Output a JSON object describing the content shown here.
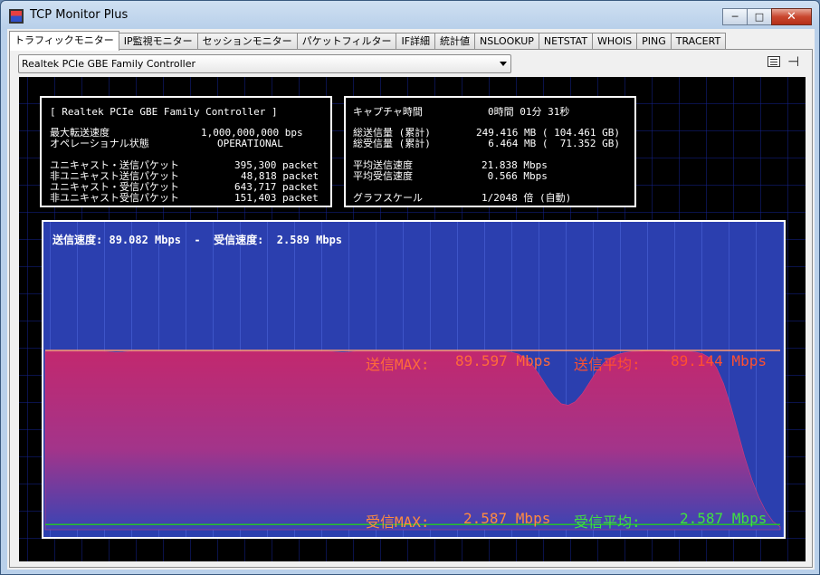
{
  "window": {
    "title": "TCP Monitor Plus",
    "minimize_glyph": "─",
    "maximize_glyph": "□",
    "close_glyph": "✕"
  },
  "tabs": [
    {
      "label": "トラフィックモニター",
      "active": true
    },
    {
      "label": "IP監視モニター"
    },
    {
      "label": "セッションモニター"
    },
    {
      "label": "パケットフィルター"
    },
    {
      "label": "IF詳細"
    },
    {
      "label": "統計値"
    },
    {
      "label": "NSLOOKUP"
    },
    {
      "label": "NETSTAT"
    },
    {
      "label": "WHOIS"
    },
    {
      "label": "PING"
    },
    {
      "label": "TRACERT"
    }
  ],
  "adapter_select": {
    "value": "Realtek PCIe GBE Family Controller"
  },
  "toolbar_icons": [
    "menu-icon",
    "pin-icon"
  ],
  "interface_info": {
    "header": "[ Realtek PCIe GBE Family Controller ]",
    "rows": [
      {
        "label": "最大転送速度",
        "value": "1,000,000,000 bps"
      },
      {
        "label": "オペレーショナル状態",
        "value": "OPERATIONAL"
      },
      {
        "label": "ユニキャスト・送信パケット",
        "value": "395,300 packet"
      },
      {
        "label": "非ユニキャスト送信パケット",
        "value": "48,818 packet"
      },
      {
        "label": "ユニキャスト・受信パケット",
        "value": "643,717 packet"
      },
      {
        "label": "非ユニキャスト受信パケット",
        "value": "151,403 packet"
      }
    ]
  },
  "capture_info": {
    "rows": [
      {
        "label": "キャプチャ時間",
        "value": "0時間 01分 31秒"
      },
      {
        "label": "総送信量 (累計)",
        "value": "249.416 MB ( 104.461 GB)"
      },
      {
        "label": "総受信量 (累計)",
        "value": "  6.464 MB (  71.352 GB)"
      },
      {
        "label": "平均送信速度",
        "value": "21.838 Mbps"
      },
      {
        "label": "平均受信速度",
        "value": " 0.566 Mbps"
      },
      {
        "label": "グラフスケール",
        "value": "1/2048 倍 (自動)"
      }
    ]
  },
  "graph": {
    "send_speed_label": "送信速度:",
    "send_speed_value": "89.082 Mbps",
    "separator": "-",
    "recv_speed_label": "受信速度:",
    "recv_speed_value": "2.589 Mbps",
    "send_max_label": "送信MAX:",
    "send_max_value": "89.597 Mbps",
    "send_avg_label": "送信平均:",
    "send_avg_value": "89.144 Mbps",
    "recv_max_label": "受信MAX:",
    "recv_max_value": "2.587 Mbps",
    "recv_avg_label": "受信平均:",
    "recv_avg_value": "2.587 Mbps",
    "colors": {
      "background": "#2b3faf",
      "send_fill_top": "#c2286e",
      "send_line": "#ff9a70",
      "recv_line": "#24c02c",
      "send_text": "#ff6a3a",
      "recv_text_label": "#ff8a40",
      "recv_avg_text": "#40e040"
    },
    "scale_mbps": 120,
    "send_series_mbps": [
      89.1,
      89.1,
      89.1,
      89.1,
      89.1,
      89.1,
      89.1,
      89.1,
      89.1,
      88.9,
      88.6,
      88.8,
      89.1,
      89.1,
      89.1,
      89.1,
      89.1,
      89.1,
      89.1,
      89.1,
      89.1,
      89.1,
      89.1,
      89.1,
      89.1,
      89.1,
      89.1,
      89.1,
      89.1,
      89.1,
      89.1,
      89.1,
      89.1,
      89.1,
      89.1,
      89.1,
      89.1,
      89.1,
      89.1,
      89.1,
      89.1,
      88.9,
      88.6,
      88.8,
      89.1,
      89.1,
      89.1,
      89.1,
      89.1,
      89.1,
      89.1,
      89.1,
      89.1,
      89.1,
      89.1,
      89.1,
      89.1,
      89.1,
      89.1,
      89.1,
      89.1,
      89.1,
      89.1,
      89.1,
      89.1,
      89.0,
      88.7,
      87.8,
      85.7,
      82.0,
      77.0,
      71.5,
      66.5,
      63.0,
      62.2,
      64.0,
      68.0,
      73.5,
      79.0,
      83.2,
      86.0,
      87.6,
      88.5,
      89.0,
      89.1,
      89.3,
      89.6,
      89.5,
      89.2,
      89.1,
      89.1,
      89.1,
      88.8,
      88.0,
      86.0,
      81.0,
      73.0,
      62.0,
      49.0,
      36.0,
      25.0,
      16.0,
      9.0,
      4.0,
      1.5
    ]
  }
}
